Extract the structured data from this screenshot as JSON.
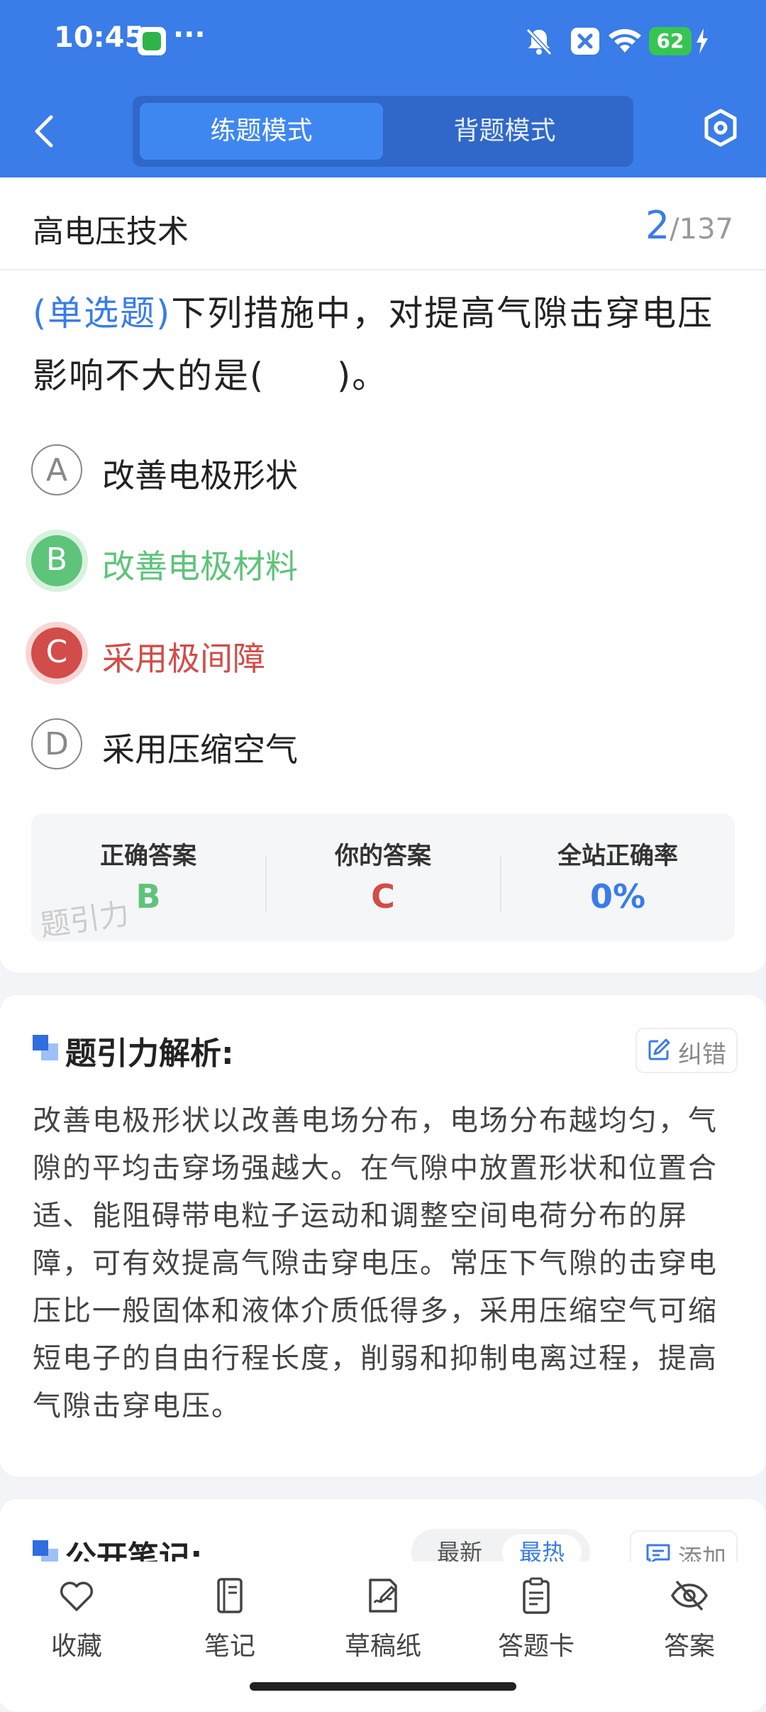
{
  "status_bar": {
    "time": "10:45",
    "dots": "···",
    "battery": "62"
  },
  "header": {
    "tabs": [
      "练题模式",
      "背题模式"
    ]
  },
  "question": {
    "subject": "高电压技术",
    "progress_current": "2",
    "progress_total": "/137",
    "type_label": "(单选题)",
    "text": "下列措施中，对提高气隙击穿电压影响不大的是(　　)。",
    "options": [
      {
        "letter": "A",
        "text": "改善电极形状"
      },
      {
        "letter": "B",
        "text": "改善电极材料"
      },
      {
        "letter": "C",
        "text": "采用极间障"
      },
      {
        "letter": "D",
        "text": "采用压缩空气"
      }
    ]
  },
  "answer_summary": {
    "correct_label": "正确答案",
    "correct_value": "B",
    "your_label": "你的答案",
    "your_value": "C",
    "rate_label": "全站正确率",
    "rate_value": "0%",
    "watermark": "题引力"
  },
  "analysis": {
    "title": "题引力解析:",
    "correct_button": "纠错",
    "text": "改善电极形状以改善电场分布，电场分布越均匀，气隙的平均击穿场强越大。在气隙中放置形状和位置合适、能阻碍带电粒子运动和调整空间电荷分布的屏障，可有效提高气隙击穿电压。常压下气隙的击穿电压比一般固体和液体介质低得多，采用压缩空气可缩短电子的自由行程长度，削弱和抑制电离过程，提高气隙击穿电压。"
  },
  "notes": {
    "title": "公开笔记:",
    "sort_new": "最新",
    "sort_hot": "最热",
    "add_button": "添加"
  },
  "bottom_nav": [
    {
      "label": "收藏",
      "icon": "heart-icon"
    },
    {
      "label": "笔记",
      "icon": "notebook-icon"
    },
    {
      "label": "草稿纸",
      "icon": "draft-paper-icon"
    },
    {
      "label": "答题卡",
      "icon": "answer-card-icon"
    },
    {
      "label": "答案",
      "icon": "eye-off-icon"
    }
  ],
  "colors": {
    "primary": "#3a7ce8",
    "correct": "#5ec47a",
    "wrong": "#d24c49"
  }
}
